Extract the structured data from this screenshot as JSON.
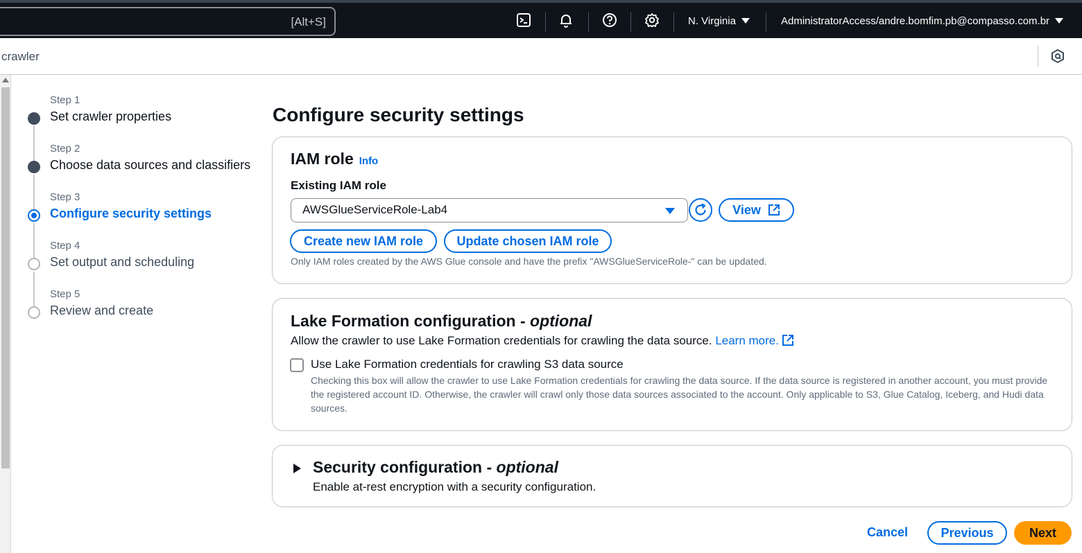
{
  "topbar": {
    "search_shortcut": "[Alt+S]",
    "icons": [
      "cloudshell-icon",
      "bell-icon",
      "help-icon",
      "gear-icon"
    ],
    "region": "N. Virginia",
    "account": "AdministratorAccess/andre.bomfim.pb@compasso.com.br"
  },
  "breadcrumb": {
    "current": "crawler"
  },
  "steps": [
    {
      "num": "Step 1",
      "title": "Set crawler properties",
      "state": "done"
    },
    {
      "num": "Step 2",
      "title": "Choose data sources and classifiers",
      "state": "done"
    },
    {
      "num": "Step 3",
      "title": "Configure security settings",
      "state": "active"
    },
    {
      "num": "Step 4",
      "title": "Set output and scheduling",
      "state": "future"
    },
    {
      "num": "Step 5",
      "title": "Review and create",
      "state": "future"
    }
  ],
  "main": {
    "title": "Configure security settings",
    "iam": {
      "heading": "IAM role",
      "info": "Info",
      "field_label": "Existing IAM role",
      "selected_role": "AWSGlueServiceRole-Lab4",
      "view_label": "View",
      "create_label": "Create new IAM role",
      "update_label": "Update chosen IAM role",
      "hint": "Only IAM roles created by the AWS Glue console and have the prefix \"AWSGlueServiceRole-\" can be updated."
    },
    "lake": {
      "heading": "Lake Formation configuration - ",
      "heading_optional": "optional",
      "description": "Allow the crawler to use Lake Formation credentials for crawling the data source.",
      "learn_more": "Learn more.",
      "checkbox_label": "Use Lake Formation credentials for crawling S3 data source",
      "checkbox_checked": false,
      "checkbox_desc": "Checking this box will allow the crawler to use Lake Formation credentials for crawling the data source. If the data source is registered in another account, you must provide the registered account ID. Otherwise, the crawler will crawl only those data sources associated to the account. Only applicable to S3, Glue Catalog, Iceberg, and Hudi data sources."
    },
    "security": {
      "heading": "Security configuration - ",
      "heading_optional": "optional",
      "description": "Enable at-rest encryption with a security configuration."
    }
  },
  "footer": {
    "cancel": "Cancel",
    "previous": "Previous",
    "next": "Next"
  },
  "colors": {
    "accent": "#006ce0",
    "primary_button": "#ff9900",
    "topbar": "#0f141a"
  }
}
